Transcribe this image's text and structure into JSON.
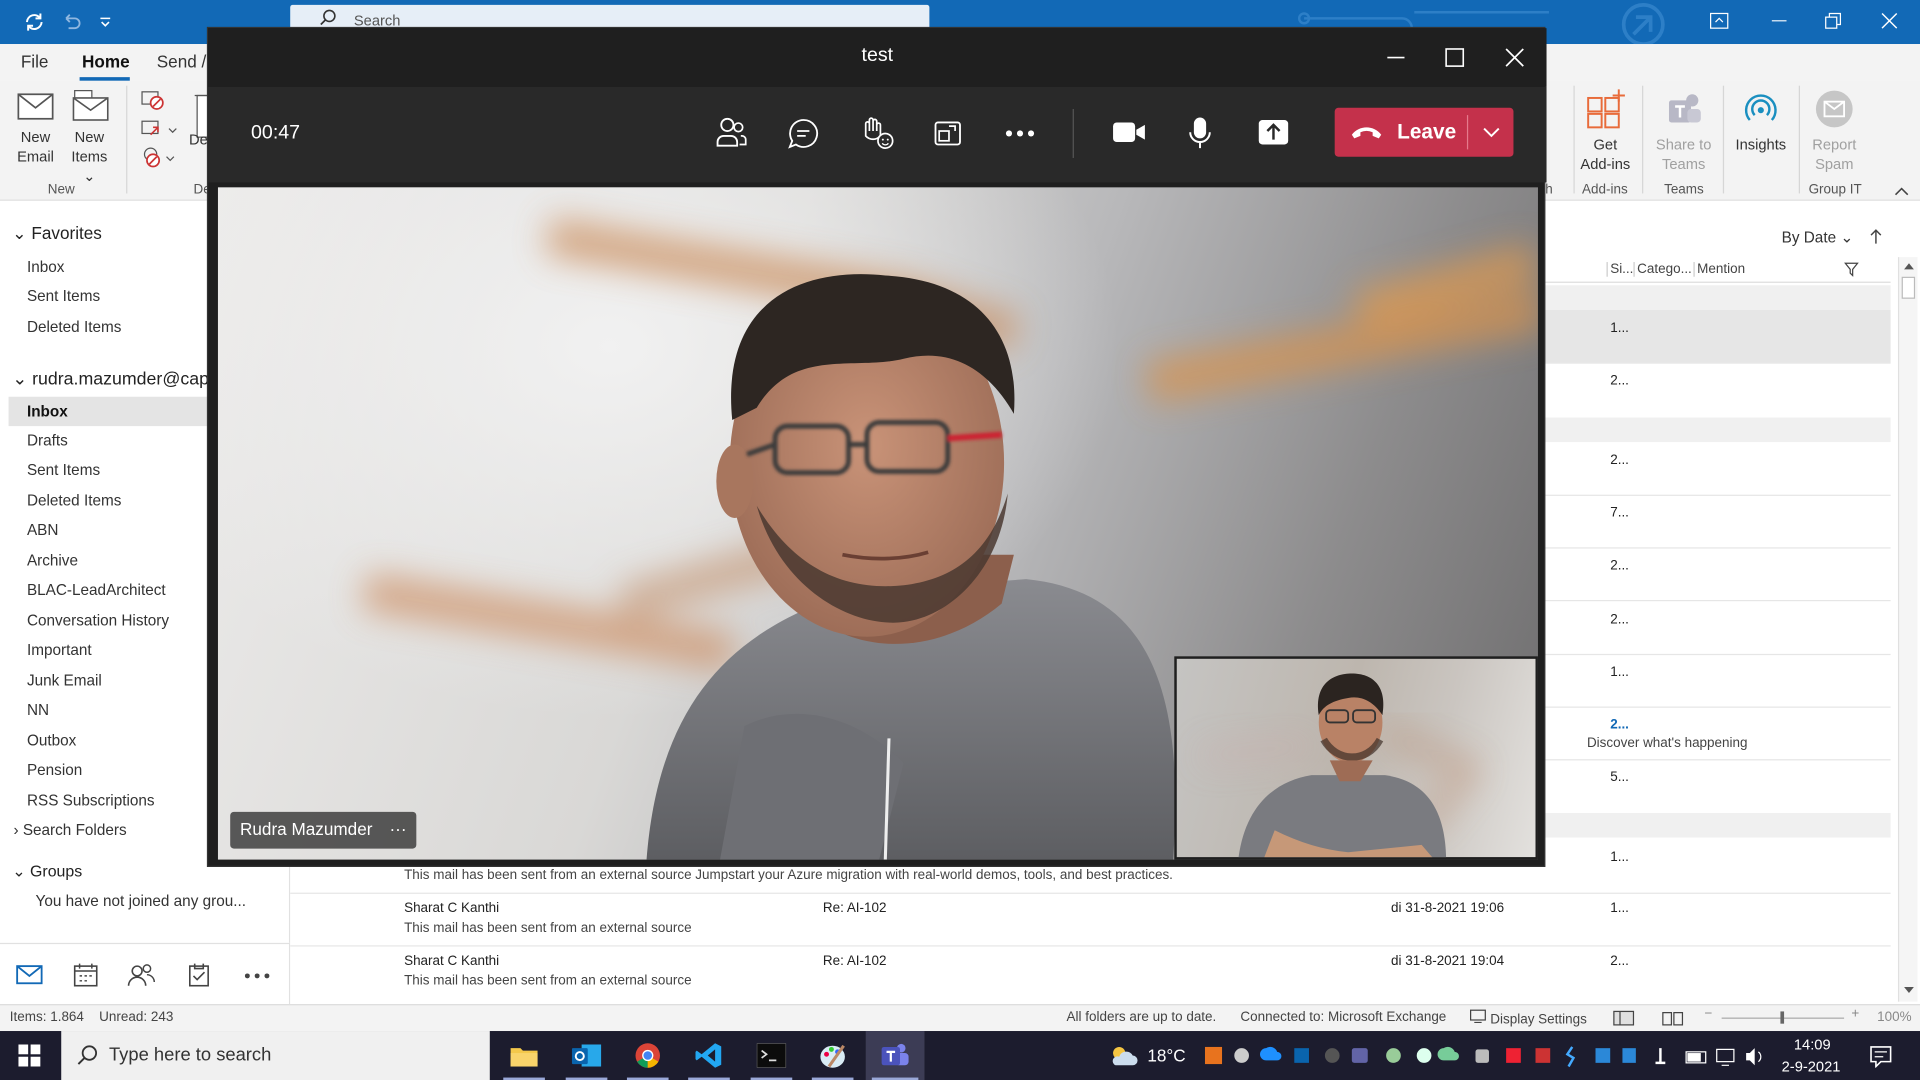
{
  "outlook": {
    "search_placeholder": "Search",
    "tabs": [
      "File",
      "Home",
      "Send /"
    ],
    "ribbon": {
      "new_email": [
        "New",
        "Email"
      ],
      "new_items": [
        "New",
        "Items ⌄"
      ],
      "delete_partial": "De",
      "get_addins": [
        "Get",
        "Add-ins"
      ],
      "share_teams": [
        "Share to",
        "Teams"
      ],
      "insights": "Insights",
      "report_spam": [
        "Report",
        "Spam"
      ],
      "groups": {
        "new": "New",
        "delete_partial": "De",
        "addins": "Add-ins",
        "teams": "Teams",
        "group_it": "Group IT",
        "h": "h"
      }
    },
    "sidebar": {
      "favorites_header": "Favorites",
      "favorites": [
        "Inbox",
        "Sent Items",
        "Deleted Items"
      ],
      "account": "rudra.mazumder@capg",
      "folders": [
        "Inbox",
        "Drafts",
        "Sent Items",
        "Deleted Items",
        "ABN",
        "Archive",
        "BLAC-LeadArchitect",
        "Conversation History",
        "Important",
        "Junk Email",
        "NN",
        "Outbox",
        "Pension",
        "RSS Subscriptions"
      ],
      "search_folders": "Search Folders",
      "groups_header": "Groups",
      "groups_note": "You have not joined any grou..."
    },
    "list": {
      "sort": "By Date",
      "columns": [
        "Si...",
        "Catego...",
        "Mention"
      ],
      "sizes": [
        "1...",
        "2...",
        "2...",
        "7...",
        "2...",
        "2...",
        "1...",
        "2...",
        "5...",
        "1...",
        "1...",
        "2..."
      ],
      "discover": "Discover what's happening",
      "rows": [
        {
          "from": "",
          "preview": "This mail has been sent from an external source  Jumpstart your Azure migration with real-world demos, tools, and best practices.",
          "subject": "",
          "date": ""
        },
        {
          "from": "Sharat C Kanthi",
          "preview": "This mail has been sent from an external source",
          "subject": "Re: AI-102",
          "date": "di 31-8-2021 19:06"
        },
        {
          "from": "Sharat C Kanthi",
          "preview": "This mail has been sent from an external source",
          "subject": "Re: AI-102",
          "date": "di 31-8-2021 19:04"
        }
      ]
    },
    "status": {
      "items": "Items: 1.864",
      "unread": "Unread: 243",
      "sync": "All folders are up to date.",
      "connected": "Connected to: Microsoft Exchange",
      "display": "Display Settings",
      "zoom": "100%"
    }
  },
  "teams": {
    "title": "test",
    "timer": "00:47",
    "leave": "Leave",
    "participant": "Rudra Mazumder",
    "more": "···"
  },
  "taskbar": {
    "search": "Type here to search",
    "temp": "18°C",
    "time": "14:09",
    "date": "2-9-2021"
  },
  "colors": {
    "outlook_blue": "#1269b6",
    "leave_red": "#c4314b",
    "taskbar": "#1c1c2e"
  }
}
